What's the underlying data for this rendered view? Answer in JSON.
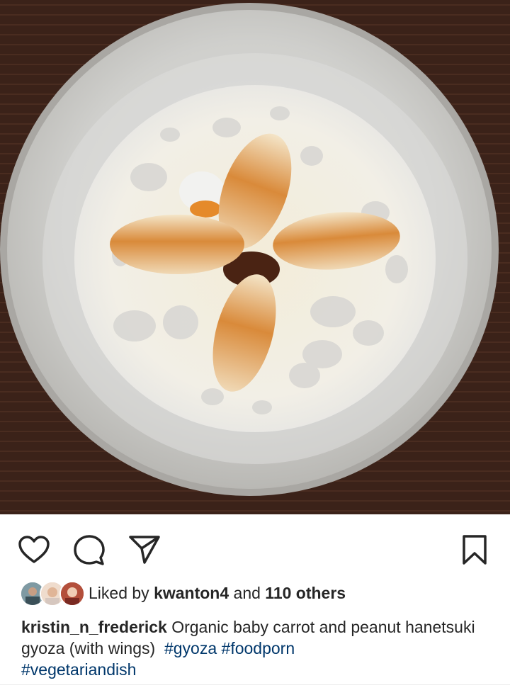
{
  "post": {
    "image_alt_name": "gyoza-dish-photo",
    "actions": {
      "like_icon": "heart-outline-icon",
      "comment_icon": "comment-bubble-icon",
      "share_icon": "paper-plane-icon",
      "save_icon": "bookmark-outline-icon"
    },
    "likes": {
      "prefix": "Liked by ",
      "user": "kwanton4",
      "middle": " and ",
      "others": "110 others"
    },
    "caption": {
      "username": "kristin_n_frederick",
      "text": " Organic baby carrot and peanut hanetsuki gyoza (with wings)  ",
      "hashtags": [
        "#gyoza",
        "#foodporn",
        "#vegetariandish"
      ]
    }
  },
  "colors": {
    "text": "#262626",
    "hashtag": "#00376b",
    "background": "#ffffff"
  }
}
